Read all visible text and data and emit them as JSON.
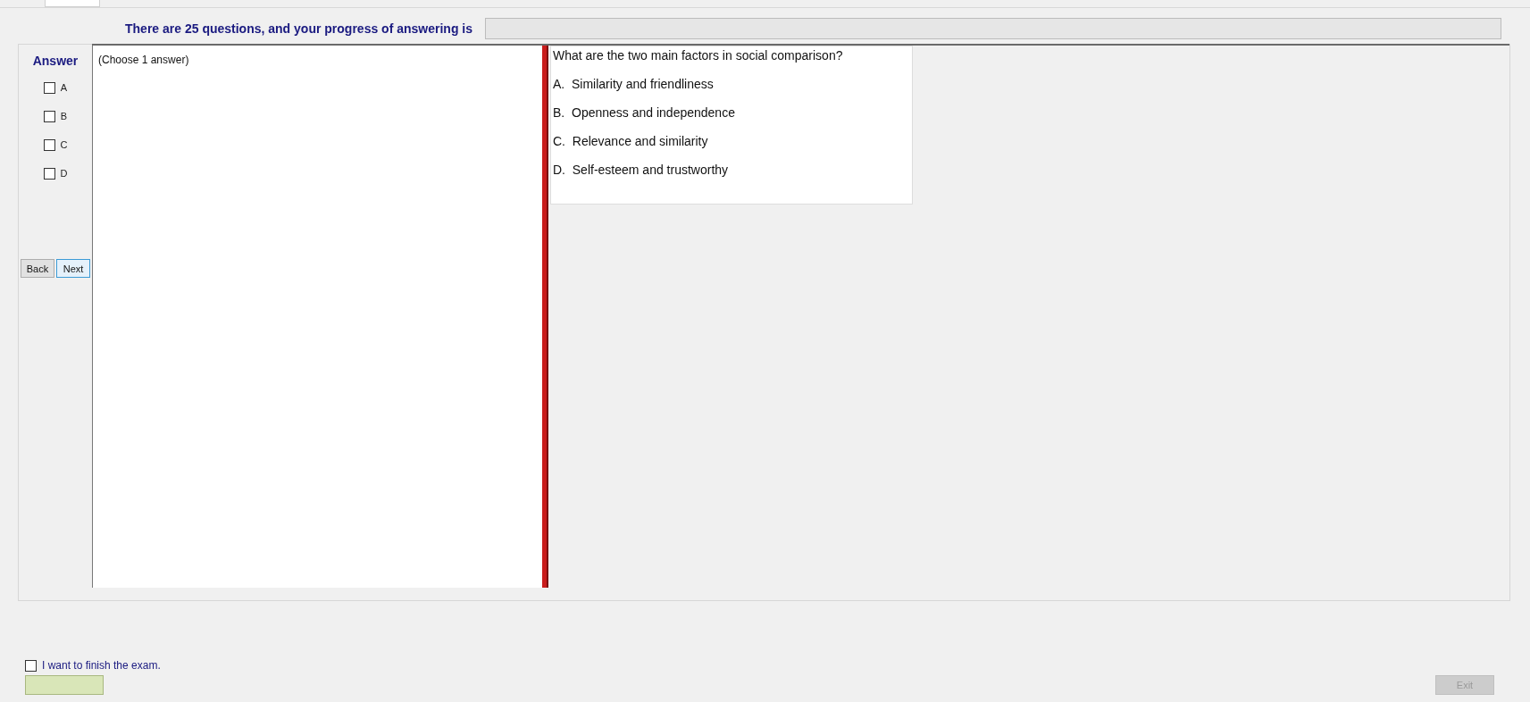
{
  "progress": {
    "label": "There are 25 questions, and your progress of answering is",
    "level": 0
  },
  "answer_panel": {
    "title": "Answer",
    "options": [
      {
        "label": "A",
        "checked": false
      },
      {
        "label": "B",
        "checked": false
      },
      {
        "label": "C",
        "checked": false
      },
      {
        "label": "D",
        "checked": false
      }
    ]
  },
  "buttons": [
    {
      "label": "Back",
      "selected": false
    },
    {
      "label": "Next",
      "selected": true
    }
  ],
  "answer_hint": "(Choose 1 answer)",
  "question": {
    "text": "What are the two main factors in social comparison?",
    "choices": [
      {
        "letter": "A.",
        "text": "Similarity and friendliness"
      },
      {
        "letter": "B.",
        "text": "Openness and independence"
      },
      {
        "letter": "C.",
        "text": "Relevance and similarity"
      },
      {
        "letter": "D.",
        "text": "Self-esteem and trustworthy"
      }
    ]
  },
  "finish": {
    "label": "I want to finish the exam.",
    "checked": false
  },
  "exit_button": {
    "label": "Exit",
    "disabled": true
  }
}
